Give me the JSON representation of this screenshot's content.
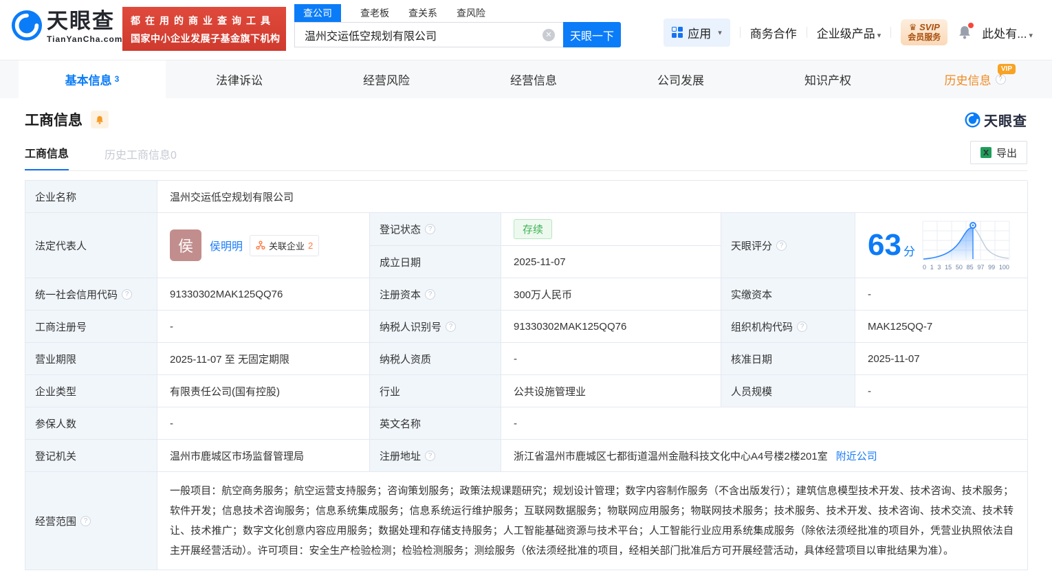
{
  "header": {
    "logo": {
      "name": "天眼查",
      "domain": "TianYanCha.com"
    },
    "slogan": {
      "line1": "都在用的商业查询工具",
      "line2": "国家中小企业发展子基金旗下机构"
    },
    "search": {
      "tabs": [
        {
          "label": "查公司"
        },
        {
          "label": "查老板"
        },
        {
          "label": "查关系"
        },
        {
          "label": "查风险"
        }
      ],
      "value": "温州交运低空规划有限公司",
      "submit": "天眼一下"
    },
    "nav": {
      "apps": "应用",
      "cooperation": "商务合作",
      "enterprise": "企业级产品",
      "svip_top": "SVIP",
      "svip_bottom": "会员服务",
      "more": "此处有..."
    }
  },
  "tabs": {
    "basic": "基本信息",
    "basic_count": "3",
    "legal": "法律诉讼",
    "risk": "经营风险",
    "operation": "经营信息",
    "development": "公司发展",
    "ip": "知识产权",
    "history": "历史信息",
    "history_vip": "VIP"
  },
  "section": {
    "title": "工商信息",
    "watermark": "天眼查",
    "subtab_active": "工商信息",
    "subtab_history": "历史工商信息",
    "subtab_history_count": "0",
    "export": "导出"
  },
  "company": {
    "name_label": "企业名称",
    "name": "温州交运低空规划有限公司",
    "rep_label": "法定代表人",
    "rep_avatar": "侯",
    "rep_name": "侯明明",
    "related_label": "关联企业",
    "related_count": "2",
    "status_label": "登记状态",
    "status": "存续",
    "established_label": "成立日期",
    "established": "2025-11-07",
    "score_label": "天眼评分",
    "score": "63",
    "score_unit": "分"
  },
  "table": {
    "rows": [
      [
        {
          "label": "统一社会信用代码",
          "value": "91330302MAK125QQ76"
        },
        {
          "label": "注册资本",
          "value": "300万人民币"
        },
        {
          "label": "实缴资本",
          "value": "-"
        }
      ],
      [
        {
          "label": "工商注册号",
          "value": "-"
        },
        {
          "label": "纳税人识别号",
          "value": "91330302MAK125QQ76"
        },
        {
          "label": "组织机构代码",
          "value": "MAK125QQ-7"
        }
      ],
      [
        {
          "label": "营业期限",
          "value": "2025-11-07 至 无固定期限"
        },
        {
          "label": "纳税人资质",
          "value": "-"
        },
        {
          "label": "核准日期",
          "value": "2025-11-07"
        }
      ],
      [
        {
          "label": "企业类型",
          "value": "有限责任公司(国有控股)"
        },
        {
          "label": "行业",
          "value": "公共设施管理业"
        },
        {
          "label": "人员规模",
          "value": "-"
        }
      ],
      [
        {
          "label": "参保人数",
          "value": "-"
        },
        {
          "label": "英文名称",
          "value": "-"
        }
      ],
      [
        {
          "label": "登记机关",
          "value": "温州市鹿城区市场监督管理局"
        },
        {
          "label": "注册地址",
          "value": "浙江省温州市鹿城区七都街道温州金融科技文化中心A4号楼2楼201室",
          "link": "附近公司"
        }
      ]
    ]
  },
  "scope": {
    "label": "经营范围",
    "text": "一般项目：航空商务服务；航空运营支持服务；咨询策划服务；政策法规课题研究；规划设计管理；数字内容制作服务（不含出版发行）；建筑信息模型技术开发、技术咨询、技术服务；软件开发；信息技术咨询服务；信息系统集成服务；信息系统运行维护服务；互联网数据服务；物联网应用服务；物联网技术服务；技术服务、技术开发、技术咨询、技术交流、技术转让、技术推广；数字文化创意内容应用服务；数据处理和存储支持服务；人工智能基础资源与技术平台；人工智能行业应用系统集成服务（除依法须经批准的项目外，凭营业执照依法自主开展经营活动）。许可项目：安全生产检验检测；检验检测服务；测绘服务（依法须经批准的项目，经相关部门批准后方可开展经营活动，具体经营项目以审批结果为准）。"
  },
  "chart_data": {
    "type": "area",
    "title": "天眼评分分布曲线",
    "marker_value": 63,
    "x_tick_labels": [
      "0",
      "1",
      "3",
      "15",
      "50",
      "85",
      "97",
      "99",
      "100"
    ]
  },
  "colors": {
    "brand_blue": "#0b7cf8",
    "link_blue": "#1a7cf9",
    "banner_red": "#d84338",
    "status_green": "#3eb354",
    "history_orange": "#ee8a22",
    "related_orange": "#ff7a45",
    "label_cell_bg": "#f1f6fb",
    "excel_green": "#1e9e5a"
  }
}
